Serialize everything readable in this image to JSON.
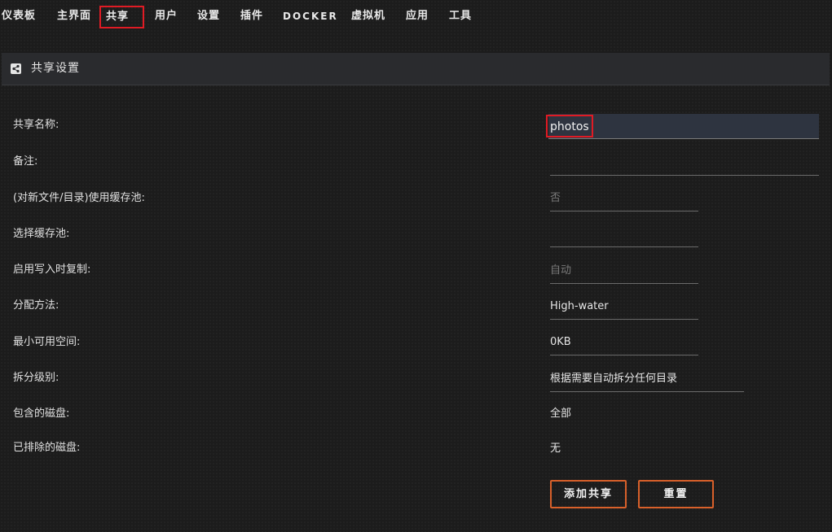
{
  "nav": {
    "items": [
      {
        "label": "仪表板"
      },
      {
        "label": "主界面"
      },
      {
        "label": "共享"
      },
      {
        "label": "用户"
      },
      {
        "label": "设置"
      },
      {
        "label": "插件"
      },
      {
        "label": "DOCKER"
      },
      {
        "label": "虚拟机"
      },
      {
        "label": "应用"
      },
      {
        "label": "工具"
      }
    ],
    "active": "共享"
  },
  "section": {
    "icon": "share-icon",
    "title": "共享设置"
  },
  "form": {
    "share_name": {
      "label": "共享名称:",
      "value": "photos"
    },
    "comment": {
      "label": "备注:",
      "value": ""
    },
    "use_cache": {
      "label": "(对新文件/目录)使用缓存池:",
      "value": "否"
    },
    "select_cache": {
      "label": "选择缓存池:",
      "value": ""
    },
    "copy_on_write": {
      "label": "启用写入时复制:",
      "value": "自动"
    },
    "allocation": {
      "label": "分配方法:",
      "value": "High-water"
    },
    "min_free": {
      "label": "最小可用空间:",
      "value": "0KB"
    },
    "split_level": {
      "label": "拆分级别:",
      "value": "根据需要自动拆分任何目录"
    },
    "included_disks": {
      "label": "包含的磁盘:",
      "value": "全部"
    },
    "excluded_disks": {
      "label": "已排除的磁盘:",
      "value": "无"
    }
  },
  "buttons": {
    "add_share": "添加共享",
    "reset": "重置"
  },
  "colors": {
    "accent": "#d8602a",
    "highlight": "#e01b24",
    "background": "#1c1c1c"
  }
}
